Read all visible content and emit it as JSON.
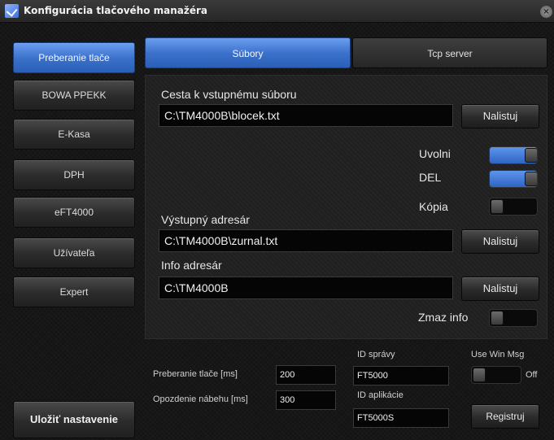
{
  "window": {
    "title": "Konfigurácia tlačového manažéra",
    "close_glyph": "×"
  },
  "sidebar": {
    "items": [
      {
        "label": "Preberanie tlače",
        "active": true
      },
      {
        "label": "BOWA PPEKK",
        "active": false
      },
      {
        "label": "E-Kasa",
        "active": false
      },
      {
        "label": "DPH",
        "active": false
      },
      {
        "label": "eFT4000",
        "active": false
      },
      {
        "label": "Užívateľa",
        "active": false
      },
      {
        "label": "Expert",
        "active": false
      }
    ],
    "save_label": "Uložiť nastavenie"
  },
  "tabs": [
    {
      "label": "Súbory",
      "active": true
    },
    {
      "label": "Tcp server",
      "active": false
    }
  ],
  "files": {
    "input_label": "Cesta k vstupnému súboru",
    "input_value": "C:\\TM4000B\\blocek.txt",
    "output_label": "Výstupný adresár",
    "output_value": "C:\\TM4000B\\zurnal.txt",
    "info_label": "Info adresár",
    "info_value": "C:\\TM4000B",
    "browse_label": "Nalistuj",
    "toggles": [
      {
        "label": "Uvolni",
        "on": true
      },
      {
        "label": "DEL",
        "on": true
      },
      {
        "label": "Kópia",
        "on": false
      }
    ],
    "clear_info_label": "Zmaz info",
    "clear_info_on": false
  },
  "bottom": {
    "print_label": "Preberanie tlače [ms]",
    "print_value": "200",
    "delay_label": "Opozdenie nábehu [ms]",
    "delay_value": "300",
    "msg_id_label": "ID správy",
    "msg_id_value": "FT5000",
    "app_id_label": "ID aplikácie",
    "app_id_value": "FT5000S",
    "win_msg_label": "Use Win Msg",
    "win_msg_state": "Off",
    "register_label": "Registruj"
  },
  "colors": {
    "accent": "#3d72cc",
    "background": "#141414"
  }
}
